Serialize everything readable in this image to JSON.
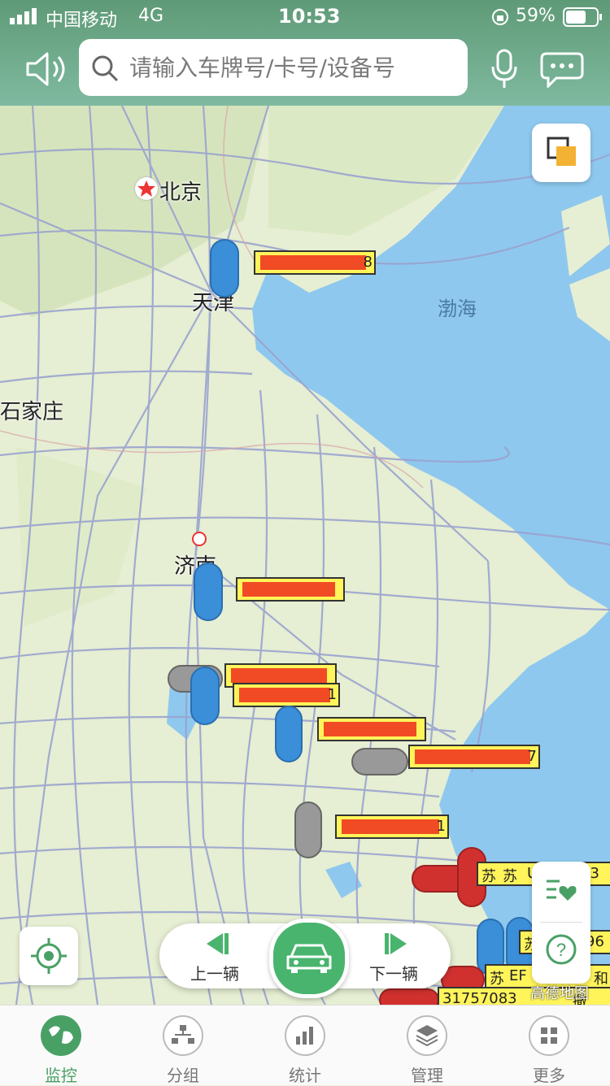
{
  "status_bar": {
    "carrier": "中国移动",
    "network": "4G",
    "time": "10:53",
    "battery": "59%"
  },
  "search": {
    "placeholder": "请输入车牌号/卡号/设备号"
  },
  "map": {
    "cities": {
      "beijing": "北京",
      "tianjin": "天津",
      "shijiazhuang": "石家庄",
      "jinan": "济南",
      "bohai": "渤海"
    },
    "attribution": "高德地图",
    "plate_fragments": [
      "8",
      "1",
      "7",
      "1",
      "苏",
      "苏",
      "U",
      "03",
      "96",
      "苏",
      "EF",
      "和",
      "31757083",
      "撒"
    ]
  },
  "nav": {
    "prev_label": "上一辆",
    "next_label": "下一辆"
  },
  "tabs": [
    {
      "label": "监控",
      "icon": "globe-icon",
      "active": true
    },
    {
      "label": "分组",
      "icon": "org-chart-icon",
      "active": false
    },
    {
      "label": "统计",
      "icon": "bar-chart-icon",
      "active": false
    },
    {
      "label": "管理",
      "icon": "layers-icon",
      "active": false
    },
    {
      "label": "更多",
      "icon": "grid-icon",
      "active": false
    }
  ],
  "colors": {
    "accent": "#49b46e",
    "plate_bg": "#fff45a",
    "redact": "#f14b25",
    "sea": "#8ec8ee"
  }
}
